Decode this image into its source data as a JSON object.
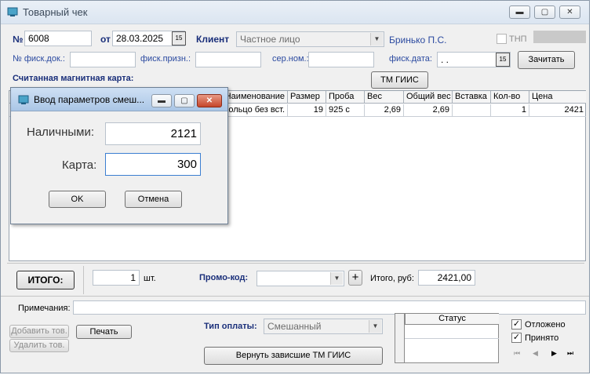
{
  "window": {
    "title": "Товарный чек"
  },
  "header": {
    "number_label": "№",
    "number_value": "6008",
    "date_label": "от",
    "date_value": "28.03.2025",
    "client_label": "Клиент",
    "client_value": "Частное лицо",
    "seller": "Бринько П.С.",
    "tnp_label": "ТНП",
    "fisc_doc_label": "№ фиск.док.:",
    "fisc_doc_value": "",
    "fisc_sign_label": "фиск.призн.:",
    "fisc_sign_value": "",
    "serial_label": "сер.ном.:",
    "serial_value": "",
    "fisc_date_label": "фиск.дата:",
    "fisc_date_value": " . .",
    "read_button": "Зачитать",
    "magnetic_card_label": "Считанная магнитная карта:",
    "tm_giis_button": "ТМ ГИИС"
  },
  "table": {
    "columns": [
      "Наименование",
      "Размер",
      "Проба",
      "Вес",
      "Общий вес",
      "Вставка",
      "Кол-во",
      "Цена"
    ],
    "rows": [
      {
        "name": "Кольцо без вст.",
        "size": "19",
        "probe": "925 с",
        "weight": "2,69",
        "total_weight": "2,69",
        "insert": "",
        "qty": "1",
        "price": "2421"
      }
    ]
  },
  "footer": {
    "total_button": "ИТОГО:",
    "qty_value": "1",
    "qty_unit": "шт.",
    "promo_label": "Промо-код:",
    "promo_value": "",
    "total_label": "Итого, руб:",
    "total_value": "2421,00",
    "notes_label": "Примечания:",
    "notes_value": "",
    "add_item_button": "Добавить тов.",
    "remove_item_button": "Удалить тов.",
    "print_button": "Печать",
    "payment_type_label": "Тип оплаты:",
    "payment_type_value": "Смешанный",
    "return_button": "Вернуть зависшие ТМ ГИИС",
    "status_header": "Статус",
    "postponed_label": "Отложено",
    "postponed_checked": true,
    "accepted_label": "Принято",
    "accepted_checked": true
  },
  "dialog": {
    "title": "Ввод параметров смеш...",
    "cash_label": "Наличными:",
    "cash_value": "2121",
    "card_label": "Карта:",
    "card_value": "300",
    "ok_button": "OK",
    "cancel_button": "Отмена"
  }
}
